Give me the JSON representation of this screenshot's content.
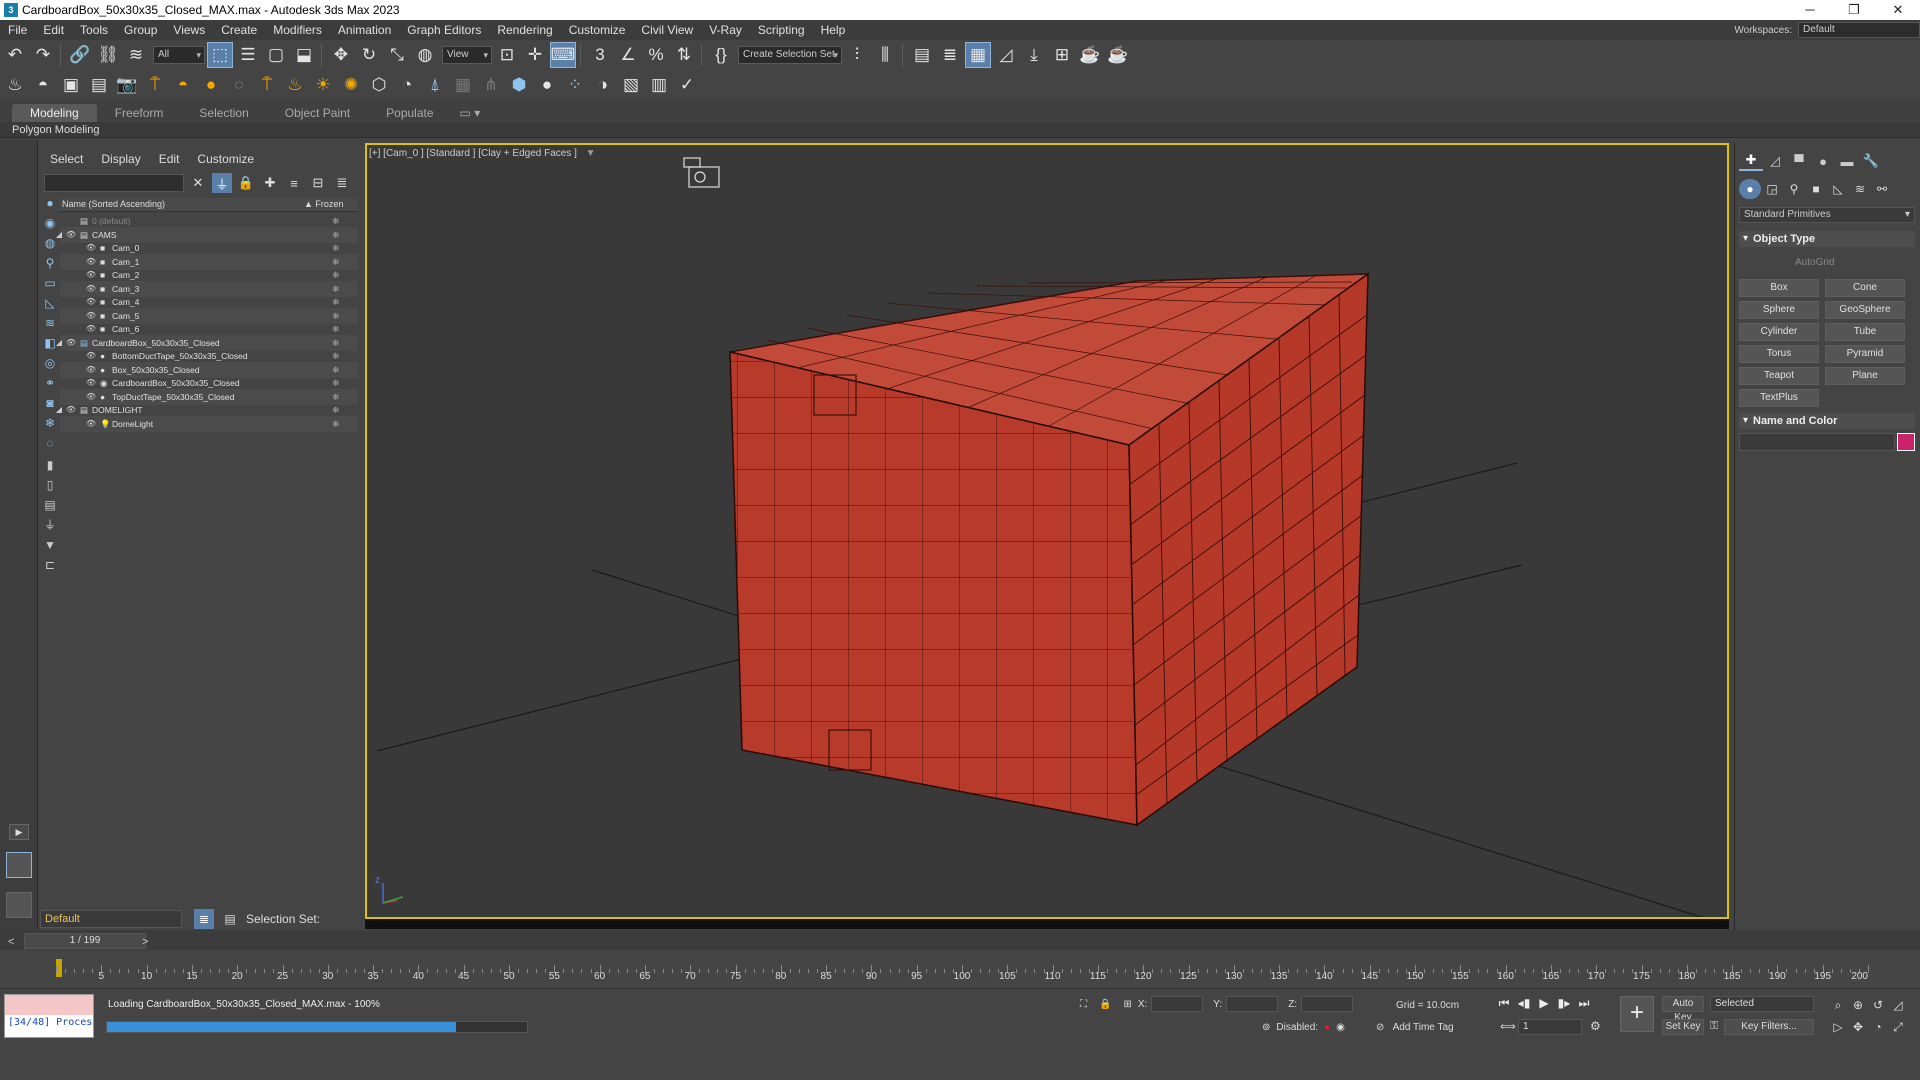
{
  "window": {
    "title": "CardboardBox_50x30x35_Closed_MAX.max - Autodesk 3ds Max 2023",
    "minimize": "─",
    "restore": "❐",
    "close": "✕"
  },
  "menubar": {
    "items": [
      "File",
      "Edit",
      "Tools",
      "Group",
      "Views",
      "Create",
      "Modifiers",
      "Animation",
      "Graph Editors",
      "Rendering",
      "Customize",
      "Civil View",
      "V-Ray",
      "Scripting",
      "Help"
    ],
    "workspaces_label": "Workspaces:",
    "workspaces_value": "Default"
  },
  "toolbar1": {
    "filter_value": "All",
    "refcoord_value": "View",
    "selection_set_placeholder": "Create Selection Set"
  },
  "ribbon": {
    "tabs": [
      "Modeling",
      "Freeform",
      "Selection",
      "Object Paint",
      "Populate"
    ],
    "subtab": "Polygon Modeling"
  },
  "explorer": {
    "menu": [
      "Select",
      "Display",
      "Edit",
      "Customize"
    ],
    "col_name": "Name (Sorted Ascending)",
    "col_frozen": "▲ Frozen",
    "rows": [
      {
        "label": "0 (default)",
        "level": 0,
        "expand": "",
        "type": "layer",
        "dim": true
      },
      {
        "label": "CAMS",
        "level": 0,
        "expand": "◢",
        "type": "layer"
      },
      {
        "label": "Cam_0",
        "level": 1,
        "expand": "",
        "type": "camera"
      },
      {
        "label": "Cam_1",
        "level": 1,
        "expand": "",
        "type": "camera"
      },
      {
        "label": "Cam_2",
        "level": 1,
        "expand": "",
        "type": "camera"
      },
      {
        "label": "Cam_3",
        "level": 1,
        "expand": "",
        "type": "camera"
      },
      {
        "label": "Cam_4",
        "level": 1,
        "expand": "",
        "type": "camera"
      },
      {
        "label": "Cam_5",
        "level": 1,
        "expand": "",
        "type": "camera"
      },
      {
        "label": "Cam_6",
        "level": 1,
        "expand": "",
        "type": "camera"
      },
      {
        "label": "CardboardBox_50x30x35_Closed",
        "level": 0,
        "expand": "◢",
        "type": "layer-active"
      },
      {
        "label": "BottomDuctTape_50x30x35_Closed",
        "level": 1,
        "expand": "",
        "type": "mesh"
      },
      {
        "label": "Box_50x30x35_Closed",
        "level": 1,
        "expand": "",
        "type": "mesh"
      },
      {
        "label": "CardboardBox_50x30x35_Closed",
        "level": 1,
        "expand": "",
        "type": "group"
      },
      {
        "label": "TopDuctTape_50x30x35_Closed",
        "level": 1,
        "expand": "",
        "type": "mesh"
      },
      {
        "label": "DOMELIGHT",
        "level": 0,
        "expand": "◢",
        "type": "layer"
      },
      {
        "label": "DomeLight",
        "level": 1,
        "expand": "",
        "type": "light"
      }
    ],
    "layer_value": "Default",
    "selection_set_label": "Selection Set:"
  },
  "viewport": {
    "label": "[+] [Cam_0 ] [Standard ] [Clay + Edged Faces ]",
    "filter_icon": "▼",
    "axis_label": "z"
  },
  "command_panel": {
    "category": "Standard Primitives",
    "object_type_title": "Object Type",
    "autogrid": "AutoGrid",
    "buttons": [
      "Box",
      "Cone",
      "Sphere",
      "GeoSphere",
      "Cylinder",
      "Tube",
      "Torus",
      "Pyramid",
      "Teapot",
      "Plane",
      "TextPlus"
    ],
    "name_color_title": "Name and Color",
    "object_color": "#c8246a"
  },
  "timeslider": {
    "prev": "<",
    "position": "1 / 199",
    "next": ">"
  },
  "trackbar": {
    "icon": "⫽",
    "labels": [
      "5",
      "10",
      "15",
      "20",
      "25",
      "30",
      "35",
      "40",
      "45",
      "50",
      "55",
      "60",
      "65",
      "70",
      "75",
      "80",
      "85",
      "90",
      "95",
      "100",
      "105",
      "110",
      "115",
      "120",
      "125",
      "130",
      "135",
      "140",
      "145",
      "150",
      "155",
      "160",
      "165",
      "170",
      "175",
      "180",
      "185",
      "190",
      "195",
      "200"
    ]
  },
  "status": {
    "script_text": "[34/48] Proces",
    "message": "Loading CardboardBox_50x30x35_Closed_MAX.max  -  100%",
    "progress": 0.83,
    "x_label": "X:",
    "y_label": "Y:",
    "z_label": "Z:",
    "grid": "Grid = 10.0cm",
    "disabled": "Disabled:",
    "add_time_tag": "Add Time Tag",
    "frame_value": "1",
    "auto_key": "Auto Key",
    "set_key": "Set Key",
    "key_select": "Selected",
    "key_filters": "Key Filters..."
  },
  "colors": {
    "accent_yellow": "#e0c300",
    "box_red": "#b83a2a",
    "progress_blue": "#3a8fd9"
  }
}
